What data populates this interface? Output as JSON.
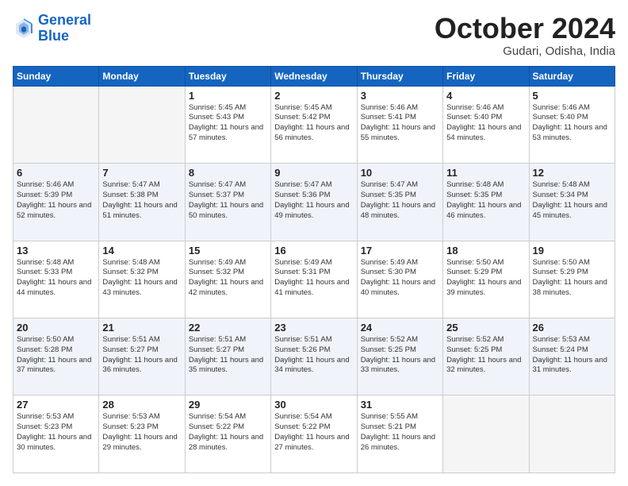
{
  "logo": {
    "line1": "General",
    "line2": "Blue"
  },
  "title": "October 2024",
  "location": "Gudari, Odisha, India",
  "weekdays": [
    "Sunday",
    "Monday",
    "Tuesday",
    "Wednesday",
    "Thursday",
    "Friday",
    "Saturday"
  ],
  "weeks": [
    [
      {
        "day": "",
        "rise": "",
        "set": "",
        "daylight": ""
      },
      {
        "day": "",
        "rise": "",
        "set": "",
        "daylight": ""
      },
      {
        "day": "1",
        "rise": "Sunrise: 5:45 AM",
        "set": "Sunset: 5:43 PM",
        "daylight": "Daylight: 11 hours and 57 minutes."
      },
      {
        "day": "2",
        "rise": "Sunrise: 5:45 AM",
        "set": "Sunset: 5:42 PM",
        "daylight": "Daylight: 11 hours and 56 minutes."
      },
      {
        "day": "3",
        "rise": "Sunrise: 5:46 AM",
        "set": "Sunset: 5:41 PM",
        "daylight": "Daylight: 11 hours and 55 minutes."
      },
      {
        "day": "4",
        "rise": "Sunrise: 5:46 AM",
        "set": "Sunset: 5:40 PM",
        "daylight": "Daylight: 11 hours and 54 minutes."
      },
      {
        "day": "5",
        "rise": "Sunrise: 5:46 AM",
        "set": "Sunset: 5:40 PM",
        "daylight": "Daylight: 11 hours and 53 minutes."
      }
    ],
    [
      {
        "day": "6",
        "rise": "Sunrise: 5:46 AM",
        "set": "Sunset: 5:39 PM",
        "daylight": "Daylight: 11 hours and 52 minutes."
      },
      {
        "day": "7",
        "rise": "Sunrise: 5:47 AM",
        "set": "Sunset: 5:38 PM",
        "daylight": "Daylight: 11 hours and 51 minutes."
      },
      {
        "day": "8",
        "rise": "Sunrise: 5:47 AM",
        "set": "Sunset: 5:37 PM",
        "daylight": "Daylight: 11 hours and 50 minutes."
      },
      {
        "day": "9",
        "rise": "Sunrise: 5:47 AM",
        "set": "Sunset: 5:36 PM",
        "daylight": "Daylight: 11 hours and 49 minutes."
      },
      {
        "day": "10",
        "rise": "Sunrise: 5:47 AM",
        "set": "Sunset: 5:35 PM",
        "daylight": "Daylight: 11 hours and 48 minutes."
      },
      {
        "day": "11",
        "rise": "Sunrise: 5:48 AM",
        "set": "Sunset: 5:35 PM",
        "daylight": "Daylight: 11 hours and 46 minutes."
      },
      {
        "day": "12",
        "rise": "Sunrise: 5:48 AM",
        "set": "Sunset: 5:34 PM",
        "daylight": "Daylight: 11 hours and 45 minutes."
      }
    ],
    [
      {
        "day": "13",
        "rise": "Sunrise: 5:48 AM",
        "set": "Sunset: 5:33 PM",
        "daylight": "Daylight: 11 hours and 44 minutes."
      },
      {
        "day": "14",
        "rise": "Sunrise: 5:48 AM",
        "set": "Sunset: 5:32 PM",
        "daylight": "Daylight: 11 hours and 43 minutes."
      },
      {
        "day": "15",
        "rise": "Sunrise: 5:49 AM",
        "set": "Sunset: 5:32 PM",
        "daylight": "Daylight: 11 hours and 42 minutes."
      },
      {
        "day": "16",
        "rise": "Sunrise: 5:49 AM",
        "set": "Sunset: 5:31 PM",
        "daylight": "Daylight: 11 hours and 41 minutes."
      },
      {
        "day": "17",
        "rise": "Sunrise: 5:49 AM",
        "set": "Sunset: 5:30 PM",
        "daylight": "Daylight: 11 hours and 40 minutes."
      },
      {
        "day": "18",
        "rise": "Sunrise: 5:50 AM",
        "set": "Sunset: 5:29 PM",
        "daylight": "Daylight: 11 hours and 39 minutes."
      },
      {
        "day": "19",
        "rise": "Sunrise: 5:50 AM",
        "set": "Sunset: 5:29 PM",
        "daylight": "Daylight: 11 hours and 38 minutes."
      }
    ],
    [
      {
        "day": "20",
        "rise": "Sunrise: 5:50 AM",
        "set": "Sunset: 5:28 PM",
        "daylight": "Daylight: 11 hours and 37 minutes."
      },
      {
        "day": "21",
        "rise": "Sunrise: 5:51 AM",
        "set": "Sunset: 5:27 PM",
        "daylight": "Daylight: 11 hours and 36 minutes."
      },
      {
        "day": "22",
        "rise": "Sunrise: 5:51 AM",
        "set": "Sunset: 5:27 PM",
        "daylight": "Daylight: 11 hours and 35 minutes."
      },
      {
        "day": "23",
        "rise": "Sunrise: 5:51 AM",
        "set": "Sunset: 5:26 PM",
        "daylight": "Daylight: 11 hours and 34 minutes."
      },
      {
        "day": "24",
        "rise": "Sunrise: 5:52 AM",
        "set": "Sunset: 5:25 PM",
        "daylight": "Daylight: 11 hours and 33 minutes."
      },
      {
        "day": "25",
        "rise": "Sunrise: 5:52 AM",
        "set": "Sunset: 5:25 PM",
        "daylight": "Daylight: 11 hours and 32 minutes."
      },
      {
        "day": "26",
        "rise": "Sunrise: 5:53 AM",
        "set": "Sunset: 5:24 PM",
        "daylight": "Daylight: 11 hours and 31 minutes."
      }
    ],
    [
      {
        "day": "27",
        "rise": "Sunrise: 5:53 AM",
        "set": "Sunset: 5:23 PM",
        "daylight": "Daylight: 11 hours and 30 minutes."
      },
      {
        "day": "28",
        "rise": "Sunrise: 5:53 AM",
        "set": "Sunset: 5:23 PM",
        "daylight": "Daylight: 11 hours and 29 minutes."
      },
      {
        "day": "29",
        "rise": "Sunrise: 5:54 AM",
        "set": "Sunset: 5:22 PM",
        "daylight": "Daylight: 11 hours and 28 minutes."
      },
      {
        "day": "30",
        "rise": "Sunrise: 5:54 AM",
        "set": "Sunset: 5:22 PM",
        "daylight": "Daylight: 11 hours and 27 minutes."
      },
      {
        "day": "31",
        "rise": "Sunrise: 5:55 AM",
        "set": "Sunset: 5:21 PM",
        "daylight": "Daylight: 11 hours and 26 minutes."
      },
      {
        "day": "",
        "rise": "",
        "set": "",
        "daylight": ""
      },
      {
        "day": "",
        "rise": "",
        "set": "",
        "daylight": ""
      }
    ]
  ]
}
